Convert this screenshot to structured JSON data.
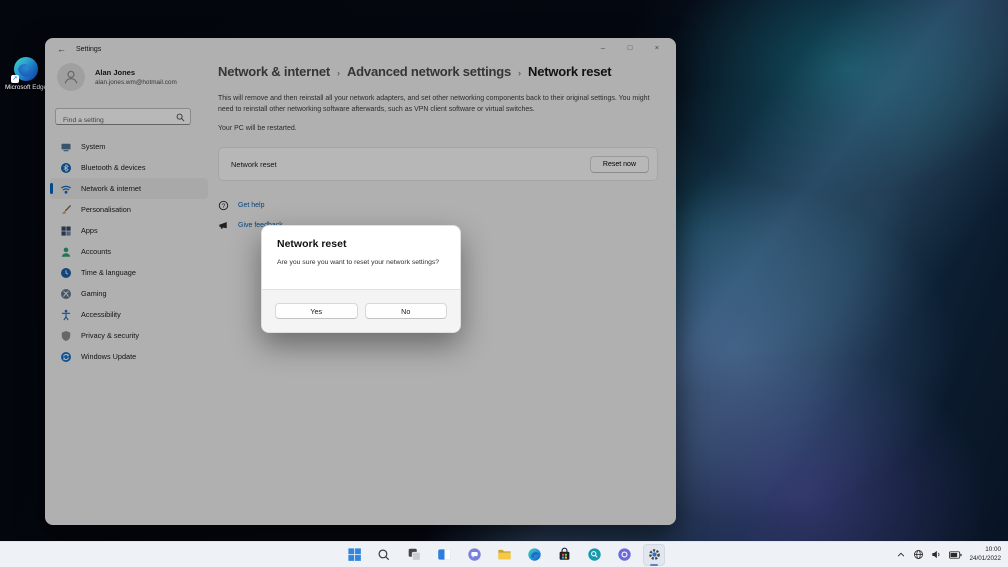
{
  "desktop": {
    "shortcut": {
      "label": "Microsoft Edge",
      "icon": "edge-icon",
      "badge_icon": "shortcut-arrow-icon",
      "badge_glyph": "↗"
    }
  },
  "settings_window": {
    "titlebar": {
      "back_glyph": "←",
      "title": "Settings",
      "minimize_glyph": "–",
      "maximize_glyph": "□",
      "close_glyph": "×"
    },
    "profile": {
      "name": "Alan Jones",
      "email": "alan.jones.wm@hotmail.com"
    },
    "search": {
      "placeholder": "Find a setting",
      "icon": "search-icon"
    },
    "sidebar": {
      "items": [
        {
          "label": "System",
          "icon": "system-icon",
          "selected": false
        },
        {
          "label": "Bluetooth & devices",
          "icon": "bluetooth-icon",
          "selected": false
        },
        {
          "label": "Network & internet",
          "icon": "network-icon",
          "selected": true
        },
        {
          "label": "Personalisation",
          "icon": "personalisation-icon",
          "selected": false
        },
        {
          "label": "Apps",
          "icon": "apps-icon",
          "selected": false
        },
        {
          "label": "Accounts",
          "icon": "accounts-icon",
          "selected": false
        },
        {
          "label": "Time & language",
          "icon": "time-language-icon",
          "selected": false
        },
        {
          "label": "Gaming",
          "icon": "gaming-icon",
          "selected": false
        },
        {
          "label": "Accessibility",
          "icon": "accessibility-icon",
          "selected": false
        },
        {
          "label": "Privacy & security",
          "icon": "privacy-security-icon",
          "selected": false
        },
        {
          "label": "Windows Update",
          "icon": "windows-update-icon",
          "selected": false
        }
      ]
    },
    "main": {
      "breadcrumb": {
        "separator": "›",
        "segments": [
          "Network & internet",
          "Advanced network settings",
          "Network reset"
        ]
      },
      "description": "This will remove and then reinstall all your network adapters, and set other networking components back to their original settings. You might need to reinstall other networking software afterwards, such as VPN client software or virtual switches.",
      "restart_note": "Your PC will be restarted.",
      "reset_row": {
        "label": "Network reset",
        "button_label": "Reset now"
      },
      "help_links": [
        {
          "label": "Get help",
          "icon": "get-help-icon"
        },
        {
          "label": "Give feedback",
          "icon": "feedback-icon"
        }
      ]
    }
  },
  "dialog": {
    "title": "Network reset",
    "message": "Are you sure you want to reset your network settings?",
    "yes_label": "Yes",
    "no_label": "No"
  },
  "taskbar": {
    "icons": [
      "start",
      "search",
      "task-view",
      "widgets",
      "chat",
      "file-explorer",
      "edge",
      "store",
      "pinned-app-teal",
      "pinned-app-purple",
      "settings"
    ],
    "active_icon": "settings",
    "tray": {
      "hidden_icons_glyph": "chevron-up",
      "network_icon": "globe",
      "volume_icon": "speaker",
      "battery_icon": "battery",
      "time": "10:00",
      "date": "24/01/2022"
    }
  },
  "colors": {
    "accent": "#0067c0",
    "link": "#0b5ca8",
    "window_bg": "#f1f1f1",
    "taskbar_bg": "#eef1f6",
    "dialog_footer": "#f4f4f4"
  }
}
